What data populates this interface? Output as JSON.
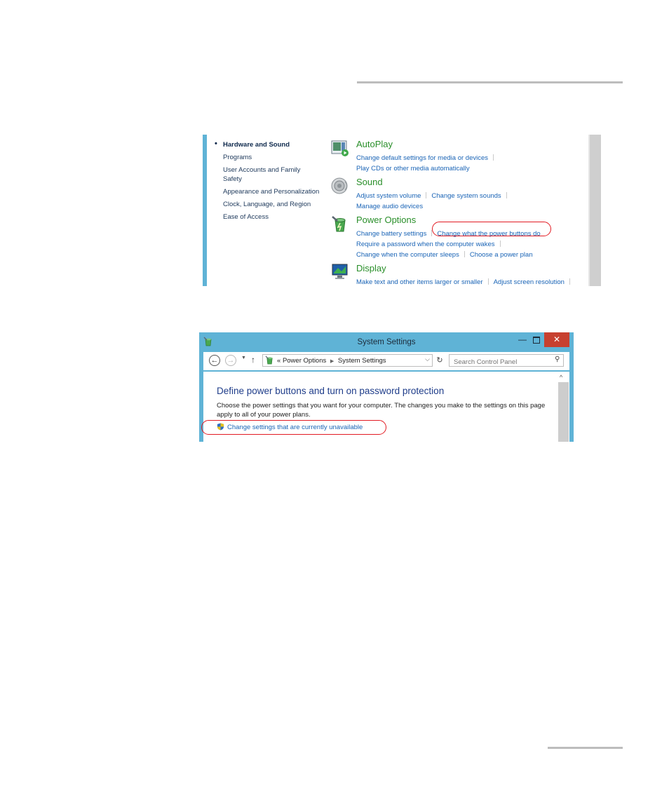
{
  "control_panel": {
    "nav_items": [
      "Hardware and Sound",
      "Programs",
      "User Accounts and Family Safety",
      "Appearance and Personalization",
      "Clock, Language, and Region",
      "Ease of Access"
    ],
    "groups": {
      "autoplay": {
        "title": "AutoPlay",
        "links": [
          "Change default settings for media or devices",
          "Play CDs or other media automatically"
        ]
      },
      "sound": {
        "title": "Sound",
        "links": [
          "Adjust system volume",
          "Change system sounds",
          "Manage audio devices"
        ]
      },
      "power": {
        "title": "Power Options",
        "links": [
          "Change battery settings",
          "Change what the power buttons do",
          "Require a password when the computer wakes",
          "Change when the computer sleeps",
          "Choose a power plan"
        ]
      },
      "display": {
        "title": "Display",
        "links": [
          "Make text and other items larger or smaller",
          "Adjust screen resolution"
        ]
      }
    }
  },
  "system_settings": {
    "window_title": "System Settings",
    "buttons": {
      "minimize": "—",
      "close": "✕"
    },
    "breadcrumb": {
      "root": "«",
      "items": [
        "Power Options",
        "System Settings"
      ]
    },
    "search_placeholder": "Search Control Panel",
    "heading": "Define power buttons and turn on password protection",
    "description": "Choose the power settings that you want for your computer. The changes you make to the settings on this page apply to all of your power plans.",
    "link": "Change settings that are currently unavailable"
  },
  "colors": {
    "accent_blue": "#5fb3d6",
    "link_blue": "#1a64b6",
    "group_green": "#2a8f2a",
    "highlight_red": "#e21b23",
    "close_red": "#c7402f"
  }
}
